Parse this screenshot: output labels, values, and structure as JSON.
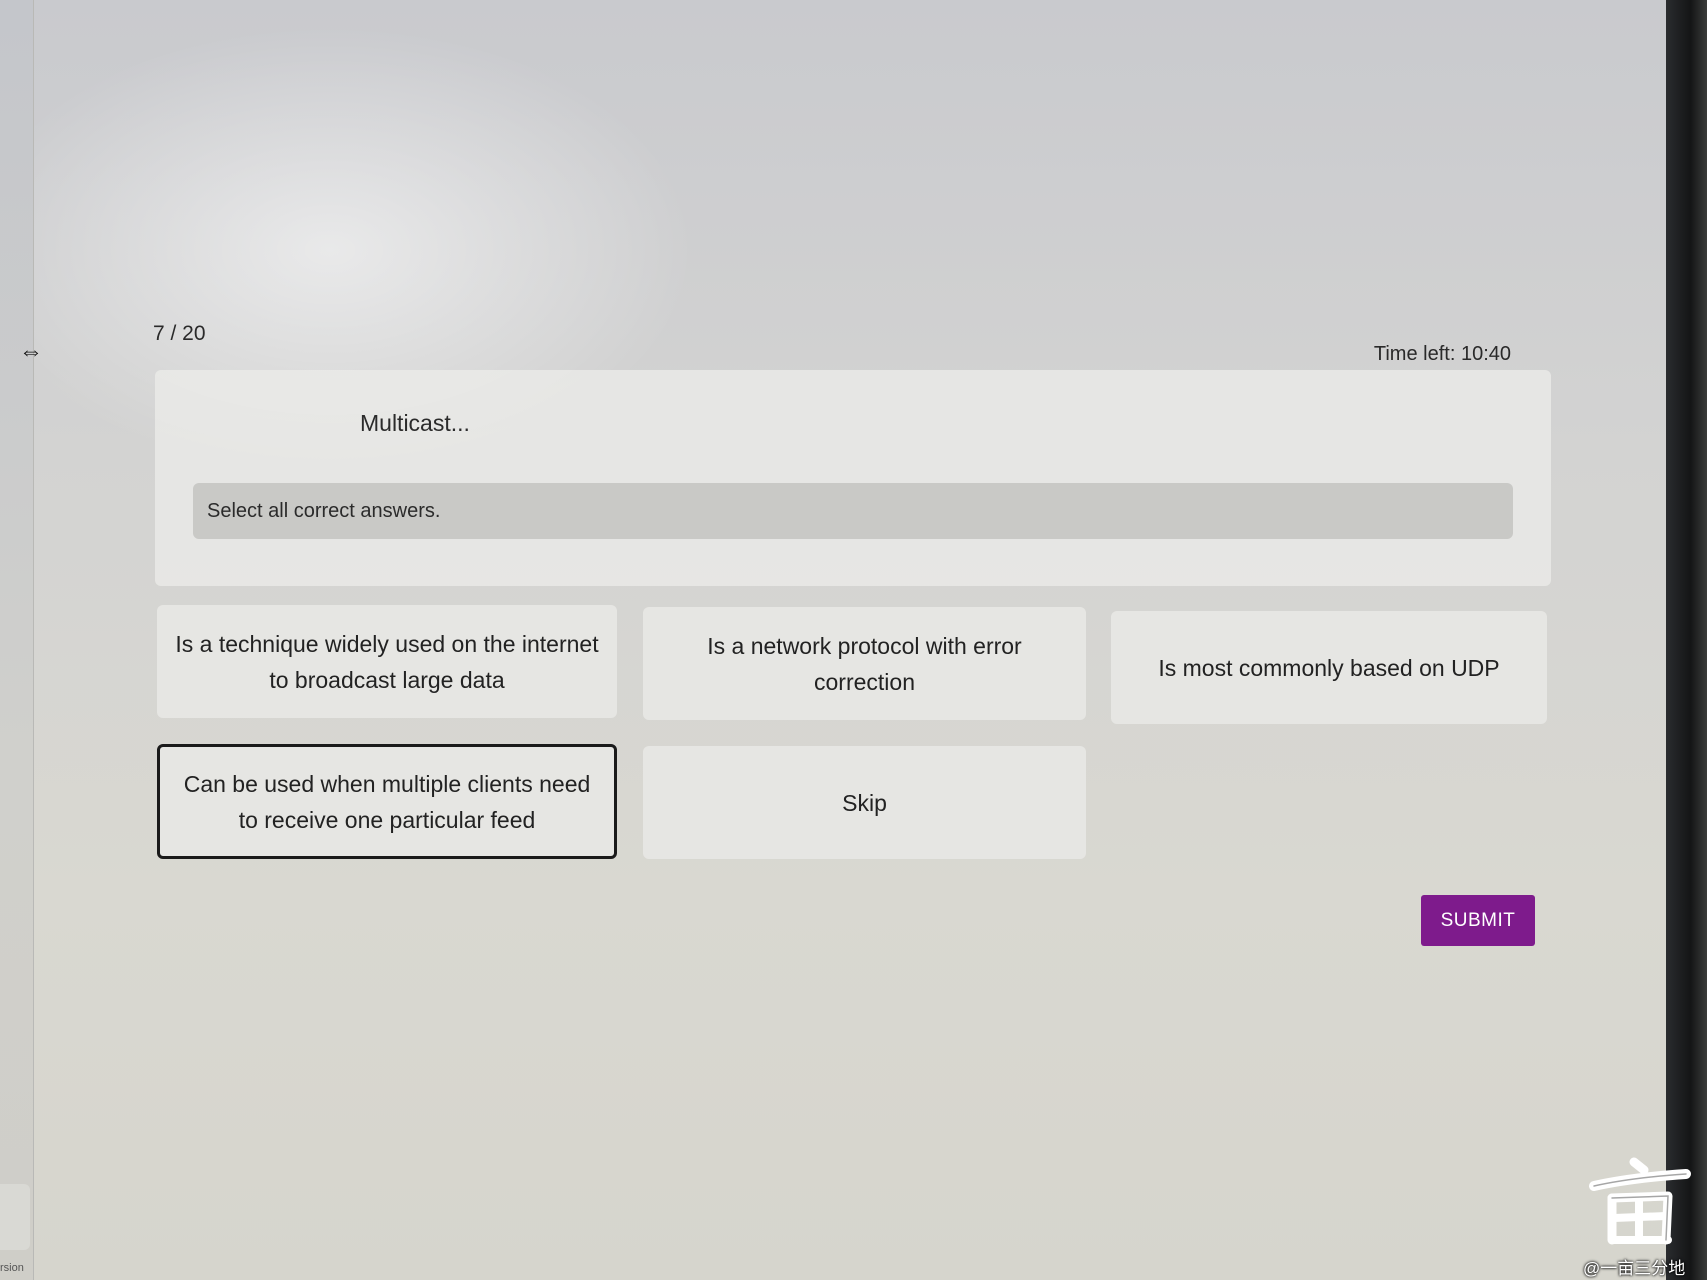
{
  "quiz": {
    "progress": "7 / 20",
    "timer": "Time left: 10:40",
    "question": "Multicast...",
    "instruction": "Select all correct answers.",
    "options": [
      {
        "label": "Is a technique widely used on the internet to broadcast large data",
        "selected": false
      },
      {
        "label": "Is a network protocol with error correction",
        "selected": false
      },
      {
        "label": "Is most commonly based on UDP",
        "selected": false
      },
      {
        "label": "Can be used when multiple clients need to receive one particular feed",
        "selected": true
      },
      {
        "label": "Skip",
        "selected": false
      }
    ],
    "submit_label": "SUBMIT",
    "accent_color": "#7e1b8c"
  },
  "watermark": {
    "caption": "@一亩三分地"
  },
  "edge": {
    "cut_text": "rsion"
  }
}
